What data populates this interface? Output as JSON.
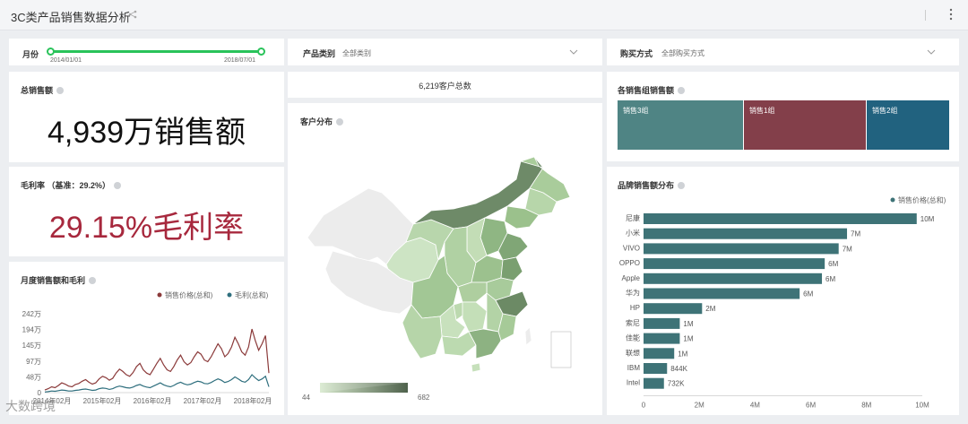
{
  "app": {
    "title": "3C类产品销售数据分析"
  },
  "filters": {
    "month": {
      "label": "月份",
      "start": "2014/01/01",
      "end": "2018/07/01"
    },
    "category": {
      "label": "产品类别",
      "value": "全部类别"
    },
    "purchase": {
      "label": "购买方式",
      "value": "全部购买方式"
    }
  },
  "kpis": {
    "total_sales": {
      "label": "总销售额",
      "value": "4,939万销售额"
    },
    "customers": {
      "value": "6,219客户总数"
    },
    "margin": {
      "label": "毛利率 （基准：29.2%）",
      "value": "29.15%毛利率"
    }
  },
  "map": {
    "label": "客户分布",
    "legend_min": "44",
    "legend_max": "682",
    "colors": {
      "low": "#d6e8cc",
      "high": "#5f7a5a",
      "none": "#ececec"
    }
  },
  "treemap": {
    "label": "各销售组销售额",
    "groups": [
      {
        "name": "销售3组",
        "color": "#4f8484"
      },
      {
        "name": "销售1组",
        "color": "#833f4a"
      },
      {
        "name": "销售2组",
        "color": "#21627f"
      }
    ]
  },
  "colors": {
    "sales_line": "#8b3a3a",
    "margin_line": "#2f6f7e",
    "bar": "#3e7377",
    "margin_text": "#a7283d",
    "slider": "#29c35a"
  },
  "chart_data": [
    {
      "type": "line",
      "title": "月度销售额和毛利",
      "x_tick_labels": [
        "2014年02月",
        "2015年02月",
        "2016年02月",
        "2017年02月",
        "2018年02月"
      ],
      "y_tick_labels": [
        "0",
        "48万",
        "97万",
        "145万",
        "194万",
        "242万"
      ],
      "ylim": [
        0,
        242
      ],
      "legend_position": "top-right",
      "series": [
        {
          "name": "销售价格(总和)",
          "color": "#8b3a3a",
          "values": [
            8,
            12,
            18,
            15,
            22,
            30,
            26,
            20,
            18,
            25,
            28,
            35,
            40,
            32,
            26,
            30,
            42,
            50,
            46,
            38,
            44,
            60,
            72,
            65,
            55,
            50,
            62,
            80,
            90,
            70,
            60,
            55,
            72,
            90,
            105,
            85,
            70,
            65,
            80,
            100,
            115,
            95,
            85,
            92,
            110,
            125,
            118,
            100,
            95,
            110,
            130,
            150,
            135,
            110,
            120,
            140,
            170,
            150,
            125,
            115,
            140,
            195,
            160,
            130,
            150,
            175,
            60
          ]
        },
        {
          "name": "毛利(总和)",
          "color": "#2f6f7e",
          "values": [
            2,
            3,
            5,
            4,
            6,
            8,
            7,
            5,
            5,
            7,
            8,
            10,
            11,
            9,
            7,
            8,
            12,
            14,
            13,
            10,
            12,
            17,
            20,
            18,
            15,
            14,
            17,
            22,
            25,
            20,
            17,
            15,
            20,
            25,
            30,
            24,
            20,
            18,
            22,
            28,
            32,
            27,
            24,
            26,
            31,
            35,
            33,
            28,
            27,
            31,
            37,
            42,
            38,
            31,
            34,
            40,
            48,
            42,
            35,
            32,
            40,
            55,
            45,
            37,
            42,
            50,
            18
          ]
        }
      ]
    },
    {
      "type": "bar",
      "title": "品牌销售额分布",
      "orientation": "horizontal",
      "legend_position": "top-right",
      "series": [
        {
          "name": "销售价格(总和)",
          "color": "#3e7377"
        }
      ],
      "categories": [
        "尼康",
        "小米",
        "VIVO",
        "OPPO",
        "Apple",
        "华为",
        "HP",
        "索尼",
        "佳能",
        "联想",
        "IBM",
        "Intel"
      ],
      "values": [
        9800000,
        7300000,
        7000000,
        6500000,
        6400000,
        5600000,
        2100000,
        1300000,
        1300000,
        1100000,
        844000,
        732000
      ],
      "value_labels": [
        "10M",
        "7M",
        "7M",
        "6M",
        "6M",
        "6M",
        "2M",
        "1M",
        "1M",
        "1M",
        "844K",
        "732K"
      ],
      "x_tick_labels": [
        "0",
        "2M",
        "4M",
        "6M",
        "8M",
        "10M"
      ],
      "xlim": [
        0,
        10000000
      ]
    }
  ],
  "watermark": "大数跨境"
}
